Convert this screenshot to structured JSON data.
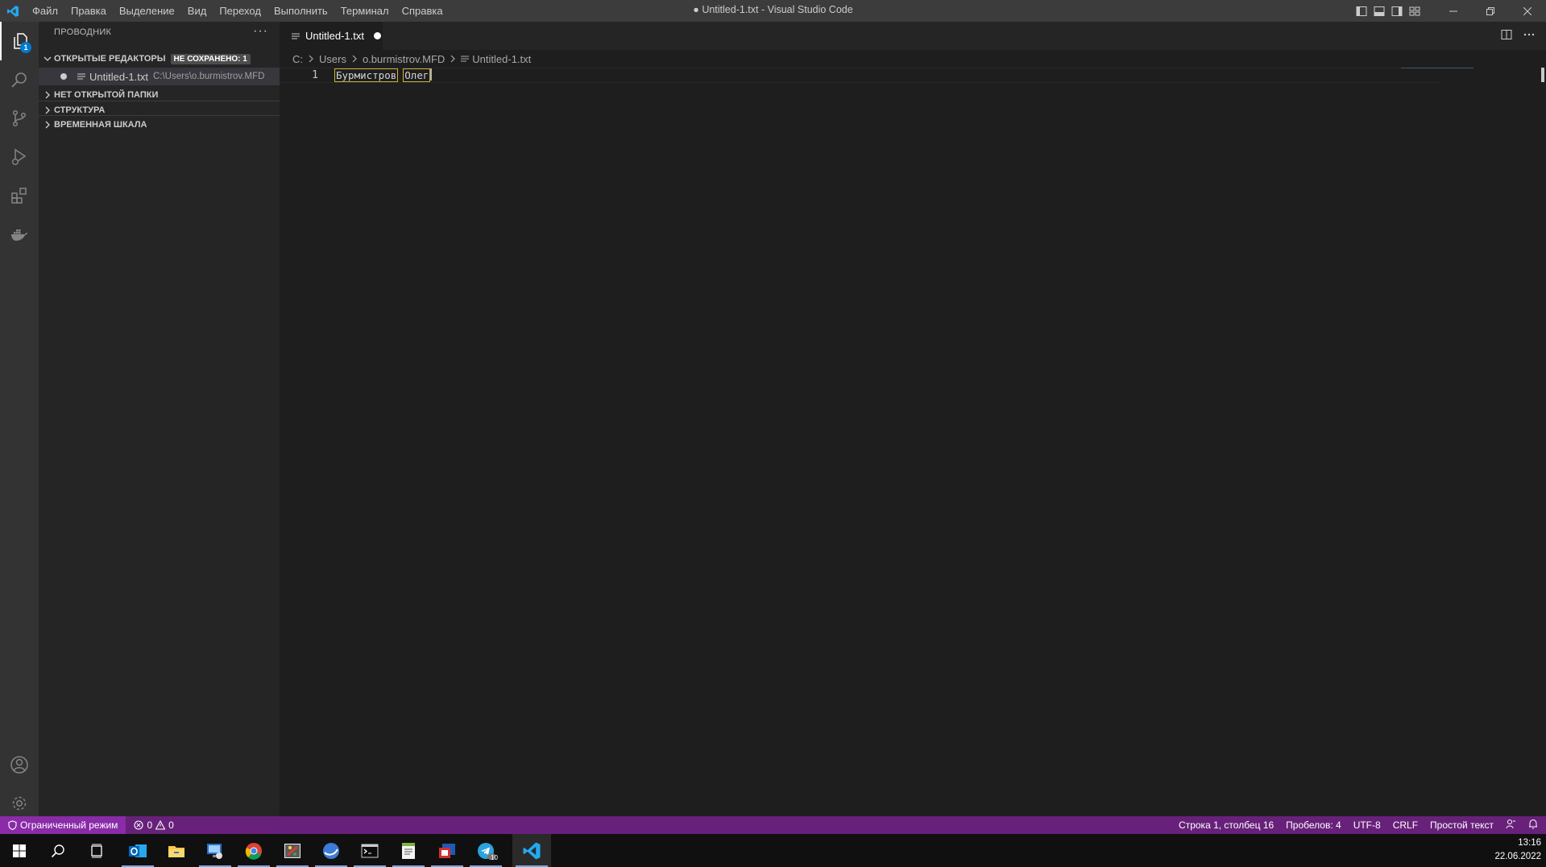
{
  "window": {
    "title": "● Untitled-1.txt - Visual Studio Code",
    "menu": [
      "Файл",
      "Правка",
      "Выделение",
      "Вид",
      "Переход",
      "Выполнить",
      "Терминал",
      "Справка"
    ]
  },
  "activity_bar": {
    "explorer_badge": "1",
    "items": [
      "explorer-icon",
      "search-icon",
      "source-control-icon",
      "run-debug-icon",
      "extensions-icon",
      "docker-icon"
    ],
    "bottom_items": [
      "account-icon",
      "settings-gear-icon"
    ]
  },
  "sidebar": {
    "title": "ПРОВОДНИК",
    "more": "···",
    "open_editors": {
      "label": "ОТКРЫТЫЕ РЕДАКТОРЫ",
      "badge": "НЕ СОХРАНЕНО: 1",
      "items": [
        {
          "name": "Untitled-1.txt",
          "path": "C:\\Users\\o.burmistrov.MFD",
          "dirty": true
        }
      ]
    },
    "sections": [
      "НЕТ ОТКРЫТОЙ ПАПКИ",
      "СТРУКТУРА",
      "ВРЕМЕННАЯ ШКАЛА"
    ]
  },
  "editor": {
    "tab": {
      "label": "Untitled-1.txt",
      "dirty": true
    },
    "breadcrumb": [
      "C:",
      "Users",
      "o.burmistrov.MFD",
      "Untitled-1.txt"
    ],
    "lines": [
      {
        "number": "1",
        "word1": "Бурмистров",
        "word2": "Олег"
      }
    ]
  },
  "status_bar": {
    "restricted_mode": "Ограниченный режим",
    "errors": "0",
    "warnings": "0",
    "position": "Строка 1, столбец 16",
    "indent": "Пробелов: 4",
    "encoding": "UTF-8",
    "eol": "CRLF",
    "language": "Простой текст",
    "accent_color": "#68217a"
  },
  "taskbar": {
    "time": "13:16",
    "date": "22.06.2022",
    "apps": [
      "start-icon",
      "search-icon",
      "task-view-icon",
      "outlook-icon",
      "file-explorer-icon",
      "remote-desktop-icon",
      "chrome-icon",
      "paint-icon",
      "globe-app-icon",
      "terminal-icon",
      "notepad-plus-icon",
      "presentation-app-icon",
      "telegram-icon",
      "vscode-icon"
    ],
    "telegram_badge": "10"
  }
}
